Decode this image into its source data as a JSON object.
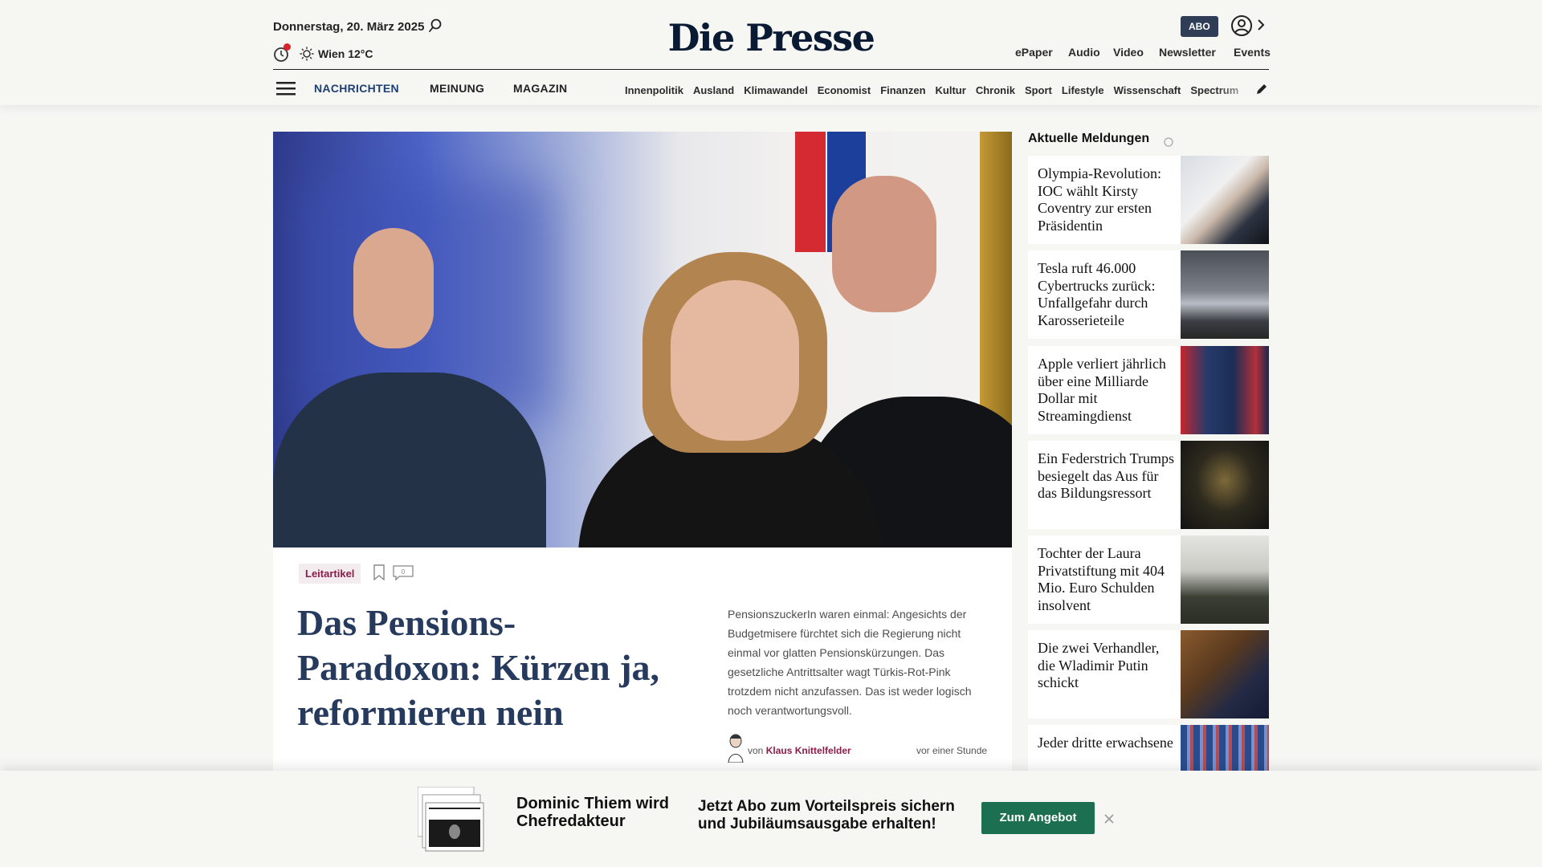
{
  "header": {
    "date": "Donnerstag, 20. März 2025",
    "weather": "Wien 12°C",
    "logo": "Die Presse",
    "abo": "ABO",
    "services": [
      "ePaper",
      "Audio",
      "Video",
      "Newsletter",
      "Events"
    ],
    "sections": [
      "NACHRICHTEN",
      "MEINUNG",
      "MAGAZIN"
    ],
    "rubrics": [
      "Innenpolitik",
      "Ausland",
      "Klimawandel",
      "Economist",
      "Finanzen",
      "Kultur",
      "Chronik",
      "Sport",
      "Lifestyle",
      "Wissenschaft",
      "Spectrum"
    ]
  },
  "lead": {
    "tag": "Leitartikel",
    "comments": "0",
    "headline": "Das Pensions-Paradoxon: Kürzen ja, reformieren nein",
    "teaser": "PensionszuckerIn waren einmal: Angesichts der Budgetmisere fürchtet sich die Regierung nicht einmal vor glatten Pensionskürzungen. Das gesetzliche Antrittsalter wagt Türkis-Rot-Pink trotzdem nicht anzufassen. Das ist weder logisch noch verantwortungsvoll.",
    "byline_prefix": "von",
    "author": "Klaus Knittelfelder",
    "time": "vor einer Stunde"
  },
  "sidebar": {
    "title": "Aktuelle Meldungen",
    "items": [
      {
        "title": "Olympia-Revolution: IOC wählt Kirsty Coventry zur ersten Präsidentin"
      },
      {
        "title": "Tesla ruft 46.000 Cybertrucks zurück: Unfallgefahr durch Karosserieteile"
      },
      {
        "title": "Apple verliert jährlich über eine Milliarde Dollar mit Streamingdienst"
      },
      {
        "title": "Ein Federstrich Trumps besiegelt das Aus für das Bildungsressort"
      },
      {
        "title": "Tochter der Laura Privatstiftung mit 404 Mio. Euro Schulden insolvent"
      },
      {
        "title": "Die zwei Verhandler, die Wladimir Putin schickt"
      },
      {
        "title": "Jeder dritte erwachsene"
      }
    ]
  },
  "promo": {
    "name": "Dominic Thiem wird Chefredakteur",
    "offer": "Jetzt Abo zum Vorteilspreis sichern und Jubiläumsausgabe erhalten!",
    "button": "Zum Angebot"
  }
}
